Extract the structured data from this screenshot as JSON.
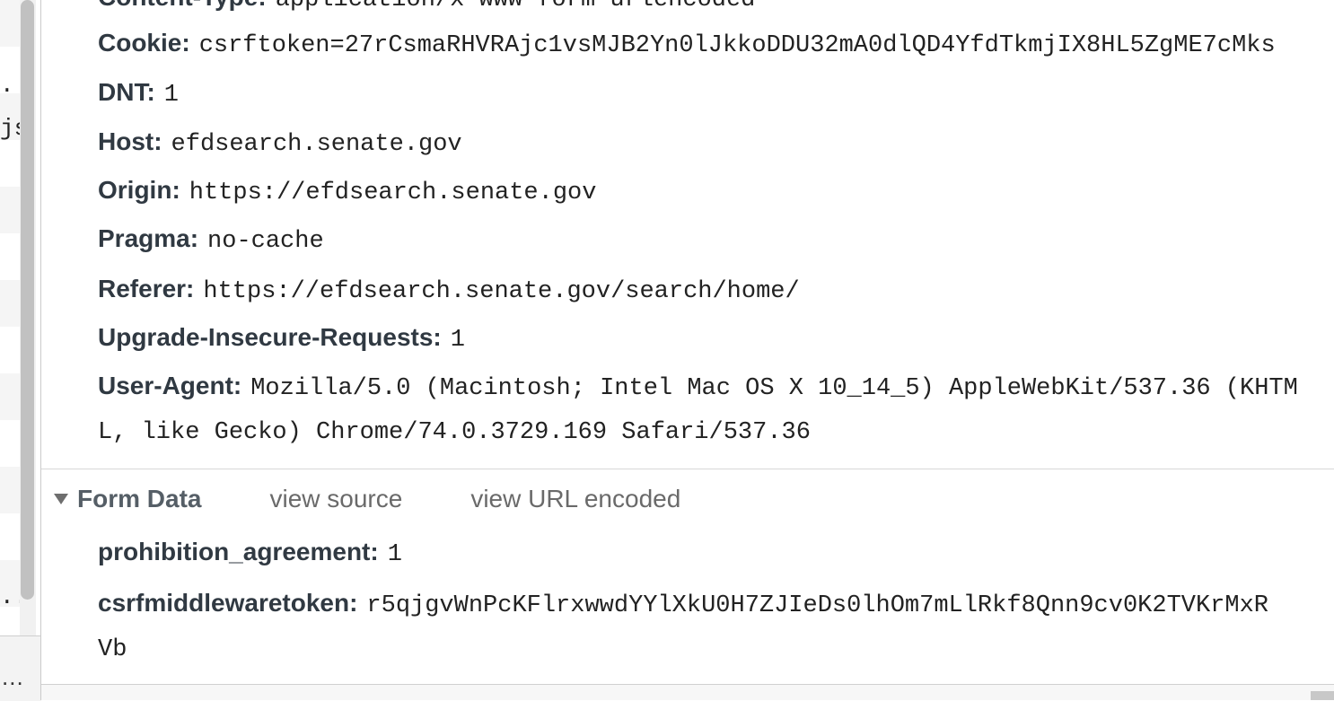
{
  "left_pane": {
    "fragments": [
      ".",
      "js",
      "..."
    ],
    "bottom_ellipsis": "..."
  },
  "request_headers": [
    {
      "key": "Content-Type:",
      "value": "application/x-www-form-urlencoded"
    },
    {
      "key": "Cookie:",
      "value": "csrftoken=27rCsmaRHVRAjc1vsMJB2Yn0lJkkoDDU32mA0dlQD4YfdTkmjIX8HL5ZgME7cMks"
    },
    {
      "key": "DNT:",
      "value": "1"
    },
    {
      "key": "Host:",
      "value": "efdsearch.senate.gov"
    },
    {
      "key": "Origin:",
      "value": "https://efdsearch.senate.gov"
    },
    {
      "key": "Pragma:",
      "value": "no-cache"
    },
    {
      "key": "Referer:",
      "value": "https://efdsearch.senate.gov/search/home/"
    },
    {
      "key": "Upgrade-Insecure-Requests:",
      "value": "1"
    },
    {
      "key": "User-Agent:",
      "value": "Mozilla/5.0 (Macintosh; Intel Mac OS X 10_14_5) AppleWebKit/537.36 (KHTM",
      "continuation": "L, like Gecko) Chrome/74.0.3729.169 Safari/537.36"
    }
  ],
  "form_data": {
    "title": "Form Data",
    "view_source": "view source",
    "view_url_encoded": "view URL encoded",
    "fields": [
      {
        "key": "prohibition_agreement:",
        "value": "1"
      },
      {
        "key": "csrfmiddlewaretoken:",
        "value": "r5qjgvWnPcKFlrxwwdYYlXkU0H7ZJIeDs0lhOm7mLlRkf8Qnn9cv0K2TVKrMxR",
        "continuation": "Vb"
      }
    ]
  }
}
